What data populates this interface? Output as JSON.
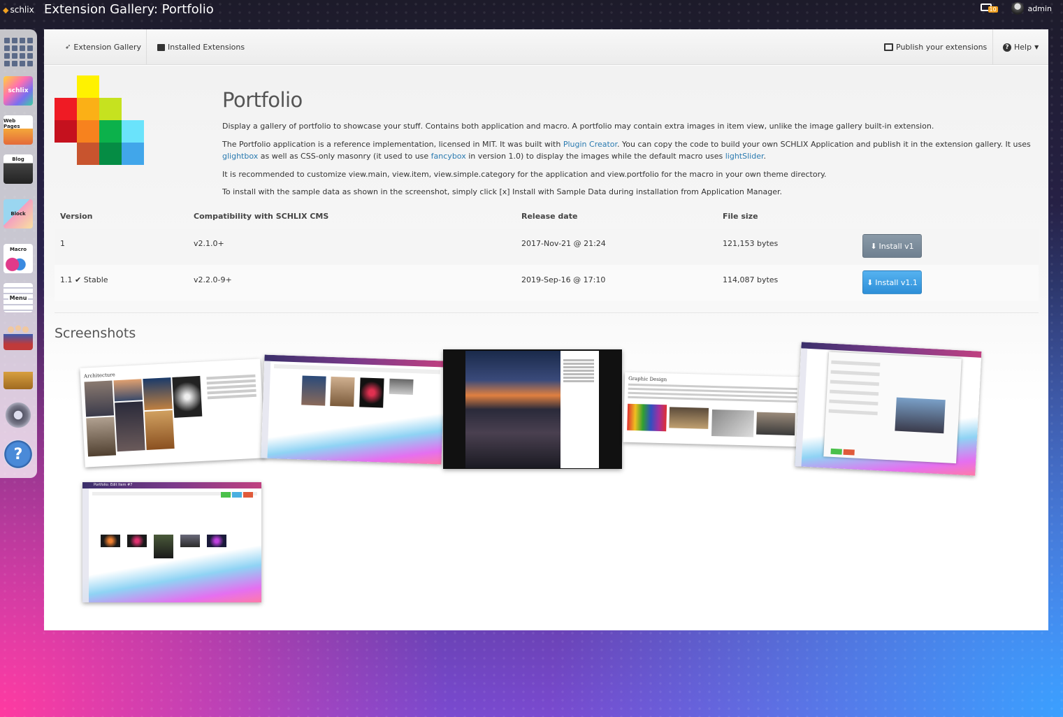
{
  "topbar": {
    "brand": "schlix",
    "title": "Extension Gallery: Portfolio",
    "notification_count": "10",
    "username": "admin"
  },
  "dock": {
    "items": [
      {
        "icon": "app-grid-icon"
      },
      {
        "icon": "schlix-icon",
        "label": "schlix"
      },
      {
        "icon": "web-pages-icon",
        "label": "Web Pages"
      },
      {
        "icon": "blog-icon",
        "label": "Blog"
      },
      {
        "icon": "block-icon",
        "label": "Block"
      },
      {
        "icon": "macro-icon",
        "label": "Macro"
      },
      {
        "icon": "menu-icon",
        "label": "Menu"
      },
      {
        "icon": "users-icon"
      },
      {
        "icon": "tools-icon"
      },
      {
        "icon": "settings-gear-icon"
      },
      {
        "icon": "help-icon"
      }
    ]
  },
  "nav": {
    "gallery": "Extension Gallery",
    "installed": "Installed Extensions",
    "publish": "Publish your extensions",
    "help": "Help"
  },
  "app": {
    "title": "Portfolio",
    "desc1": "Display a gallery of portfolio to showcase your stuff. Contains both application and macro. A portfolio may contain extra images in item view, unlike the image gallery built-in extension.",
    "desc2_a": "The Portfolio application is a reference implementation, licensed in MIT. It was built with ",
    "desc2_link1": "Plugin Creator",
    "desc2_b": ". You can copy the code to build your own SCHLIX Application and publish it in the extension gallery. It uses ",
    "desc2_link2": "glightbox",
    "desc2_c": " as well as CSS-only masonry (it used to use ",
    "desc2_link3": "fancybox",
    "desc2_d": " in version 1.0) to display the images while the default macro uses ",
    "desc2_link4": "lightSlider",
    "desc2_e": ".",
    "desc3": "It is recommended to customize view.main, view.item, view.simple.category for the application and view.portfolio for the macro in your own theme directory.",
    "desc4": "To install with the sample data as shown in the screenshot, simply click [x] Install with Sample Data during installation from Application Manager."
  },
  "versions": {
    "headers": [
      "Version",
      "Compatibility with SCHLIX CMS",
      "Release date",
      "File size"
    ],
    "rows": [
      {
        "version": "1",
        "stable": "",
        "compat": "v2.1.0+",
        "date": "2017-Nov-21 @ 21:24",
        "size": "121,153 bytes",
        "button": "Install v1"
      },
      {
        "version": "1.1",
        "stable": "Stable",
        "compat": "v2.2.0-9+",
        "date": "2019-Sep-16 @ 17:10",
        "size": "114,087 bytes",
        "button": "Install v1.1"
      }
    ]
  },
  "screenshots": {
    "title": "Screenshots",
    "captions": [
      "Architecture",
      "Graphic Design",
      "Portfolio: Edit Item #7"
    ]
  },
  "colors": {
    "link": "#2a7ab0",
    "install_grey": "#7a8b9a",
    "install_blue": "#3a9be2",
    "notification": "#f0a020"
  }
}
